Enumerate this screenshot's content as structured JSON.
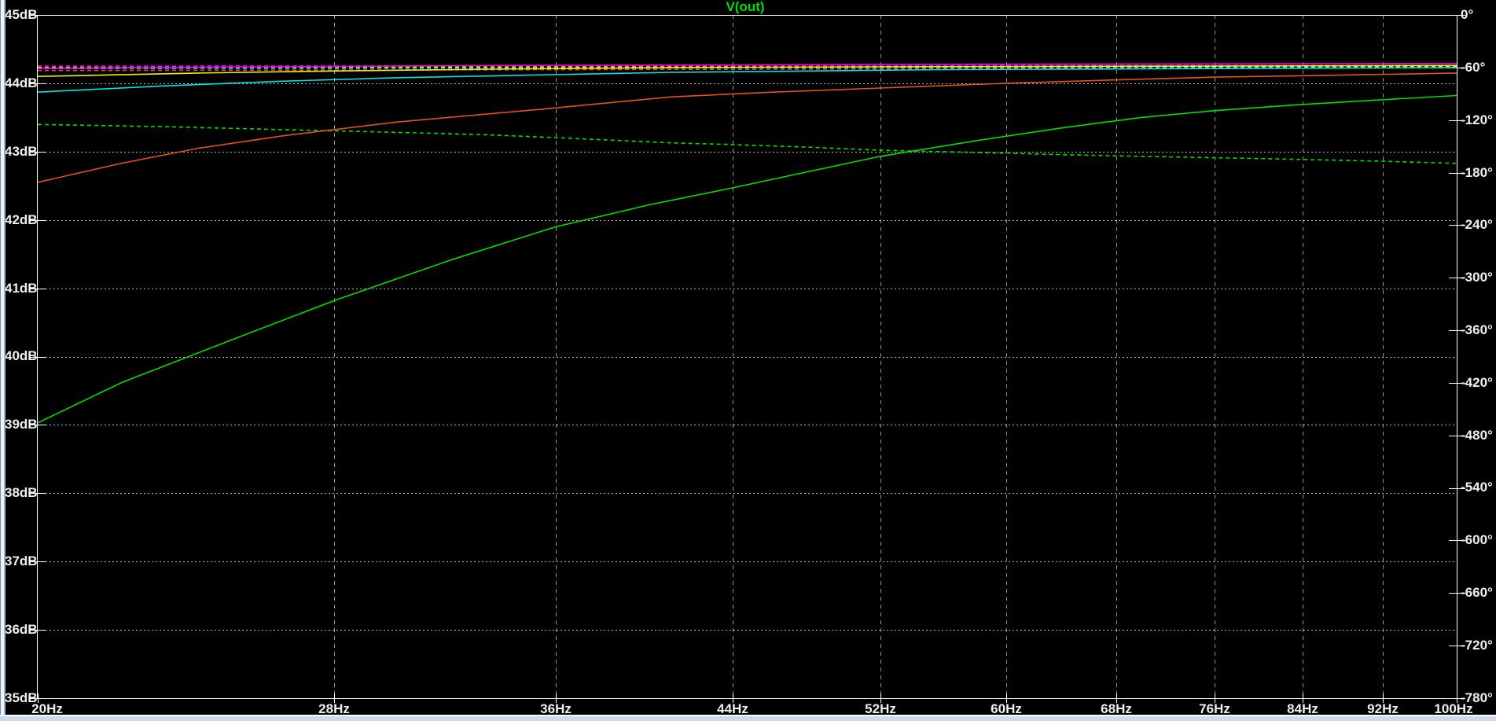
{
  "chart_data": {
    "type": "line",
    "title": "V(out)",
    "title_color": "#00E000",
    "background": "#000000",
    "border_color": "#FFFFFF",
    "label_color": "#EFEFEF",
    "x_axis": {
      "scale": "log",
      "unit": "Hz",
      "min": 20,
      "max": 100,
      "ticks": [
        20,
        28,
        36,
        44,
        52,
        60,
        68,
        76,
        84,
        92,
        100
      ],
      "labels": [
        "20Hz",
        "28Hz",
        "36Hz",
        "44Hz",
        "52Hz",
        "60Hz",
        "68Hz",
        "76Hz",
        "84Hz",
        "92Hz",
        "100Hz"
      ]
    },
    "y_axis_left": {
      "unit": "dB",
      "min": 35,
      "max": 45,
      "ticks": [
        45,
        44,
        43,
        42,
        41,
        40,
        39,
        38,
        37,
        36,
        35
      ],
      "labels": [
        "45dB",
        "44dB",
        "43dB",
        "42dB",
        "41dB",
        "40dB",
        "39dB",
        "38dB",
        "37dB",
        "36dB",
        "35dB"
      ]
    },
    "y_axis_right": {
      "unit": "deg",
      "min": -780,
      "max": 0,
      "ticks": [
        0,
        -60,
        -120,
        -180,
        -240,
        -300,
        -360,
        -420,
        -480,
        -540,
        -600,
        -660,
        -720,
        -780
      ],
      "labels": [
        "0°",
        "-60°",
        "-120°",
        "-180°",
        "-240°",
        "-300°",
        "-360°",
        "-420°",
        "-480°",
        "-540°",
        "-600°",
        "-660°",
        "-720°",
        "-780°"
      ],
      "grid_h_color": "#B8B8B8",
      "grid_v_color": "#949494"
    },
    "series": [
      {
        "name": "phase-red",
        "axis": "phase",
        "style": "dashed",
        "color": "#E8501E",
        "points": [
          [
            20,
            -63.5
          ],
          [
            30,
            -62.8
          ],
          [
            44,
            -62.0
          ],
          [
            60,
            -61.3
          ],
          [
            80,
            -60.8
          ],
          [
            100,
            -60.4
          ]
        ]
      },
      {
        "name": "phase-cyan",
        "axis": "phase",
        "style": "dashed",
        "color": "#00E5E5",
        "points": [
          [
            20,
            -61.2
          ],
          [
            35,
            -60.6
          ],
          [
            55,
            -60.0
          ],
          [
            100,
            -59.4
          ]
        ]
      },
      {
        "name": "phase-yellow",
        "axis": "phase",
        "style": "dashed",
        "color": "#F0F000",
        "points": [
          [
            20,
            -59.8
          ],
          [
            40,
            -59.2
          ],
          [
            70,
            -58.8
          ],
          [
            100,
            -58.5
          ]
        ]
      },
      {
        "name": "phase-magenta",
        "axis": "phase",
        "style": "dashed",
        "color": "#F000F0",
        "points": [
          [
            20,
            -58.4
          ],
          [
            45,
            -58.0
          ],
          [
            100,
            -57.6
          ]
        ]
      },
      {
        "name": "phase-green",
        "axis": "phase",
        "style": "dashed",
        "color": "#00E000",
        "points": [
          [
            20,
            -125
          ],
          [
            23,
            -127.5
          ],
          [
            26.4,
            -131
          ],
          [
            30,
            -134
          ],
          [
            33,
            -136.5
          ],
          [
            36,
            -140
          ],
          [
            41,
            -146
          ],
          [
            44,
            -148
          ],
          [
            48,
            -151
          ],
          [
            52,
            -154.5
          ],
          [
            58,
            -157
          ],
          [
            64,
            -159.5
          ],
          [
            70,
            -161.5
          ],
          [
            76,
            -163
          ],
          [
            84,
            -165
          ],
          [
            92,
            -167
          ],
          [
            100,
            -169.5
          ]
        ]
      },
      {
        "name": "gain-cyan",
        "axis": "gain",
        "style": "solid",
        "color": "#00E5E5",
        "points": [
          [
            20,
            43.87
          ],
          [
            23,
            43.96
          ],
          [
            26.4,
            44.03
          ],
          [
            30,
            44.08
          ],
          [
            35,
            44.12
          ],
          [
            41,
            44.16
          ],
          [
            48,
            44.18
          ],
          [
            56,
            44.2
          ],
          [
            68,
            44.21
          ],
          [
            84,
            44.22
          ],
          [
            100,
            44.23
          ]
        ]
      },
      {
        "name": "gain-yellow",
        "axis": "gain",
        "style": "solid",
        "color": "#F0F000",
        "points": [
          [
            20,
            44.1
          ],
          [
            24,
            44.15
          ],
          [
            28,
            44.18
          ],
          [
            34,
            44.21
          ],
          [
            42,
            44.23
          ],
          [
            52,
            44.24
          ],
          [
            70,
            44.25
          ],
          [
            100,
            44.26
          ]
        ]
      },
      {
        "name": "gain-magenta",
        "axis": "gain",
        "style": "solid",
        "color": "#F000F0",
        "points": [
          [
            20,
            44.22
          ],
          [
            26,
            44.24
          ],
          [
            34,
            44.26
          ],
          [
            46,
            44.27
          ],
          [
            64,
            44.28
          ],
          [
            100,
            44.29
          ]
        ]
      },
      {
        "name": "gain-red",
        "axis": "gain",
        "style": "solid",
        "color": "#E8501E",
        "points": [
          [
            20,
            42.55
          ],
          [
            22,
            42.83
          ],
          [
            24,
            43.05
          ],
          [
            26.4,
            43.23
          ],
          [
            30,
            43.43
          ],
          [
            35.4,
            43.62
          ],
          [
            41,
            43.8
          ],
          [
            46,
            43.87
          ],
          [
            52,
            43.93
          ],
          [
            60,
            44.0
          ],
          [
            68,
            44.05
          ],
          [
            76,
            44.09
          ],
          [
            84,
            44.11
          ],
          [
            92,
            44.13
          ],
          [
            100,
            44.15
          ]
        ]
      },
      {
        "name": "gain-green",
        "axis": "gain",
        "style": "solid",
        "color": "#00E000",
        "points": [
          [
            20,
            39.03
          ],
          [
            22,
            39.62
          ],
          [
            25,
            40.26
          ],
          [
            28,
            40.82
          ],
          [
            32,
            41.42
          ],
          [
            36,
            41.9
          ],
          [
            40,
            42.22
          ],
          [
            44,
            42.47
          ],
          [
            48,
            42.71
          ],
          [
            52,
            42.93
          ],
          [
            58,
            43.16
          ],
          [
            64,
            43.35
          ],
          [
            70,
            43.5
          ],
          [
            76,
            43.6
          ],
          [
            84,
            43.69
          ],
          [
            92,
            43.76
          ],
          [
            100,
            43.82
          ]
        ]
      }
    ]
  }
}
